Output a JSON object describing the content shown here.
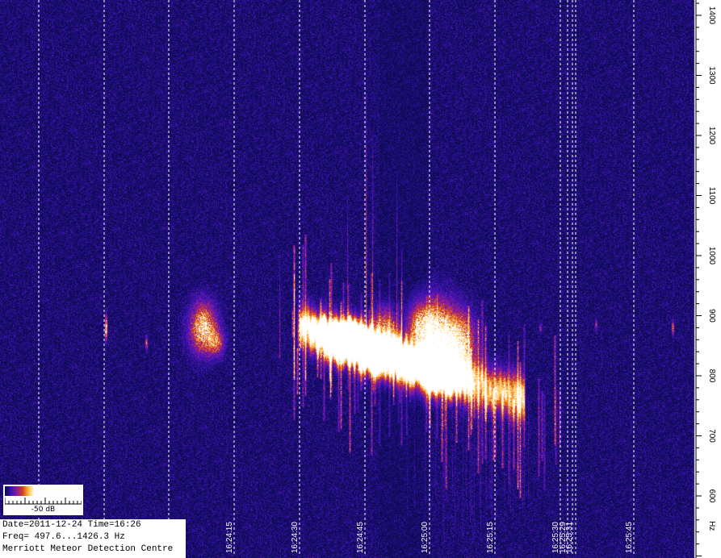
{
  "chart_data": {
    "type": "heatmap",
    "title": "",
    "xlabel": "",
    "ylabel": "Hz",
    "x_ticks": [
      "16:24:15",
      "16:24:30",
      "16:24:45",
      "16:25:00",
      "16:25:15",
      "16:25:30",
      "16:25:29",
      "16:25:31",
      "16:25:45"
    ],
    "y_ticks": [
      1400,
      1300,
      1200,
      1100,
      1000,
      900,
      800,
      700,
      600
    ],
    "ylim": [
      500,
      1410
    ],
    "grid": "vertical dashed white lines",
    "colormap": [
      "#0a0a4a",
      "#3a14b8",
      "#8a1aa0",
      "#d8401a",
      "#ffc040",
      "#ffffff"
    ],
    "legend": {
      "label": "-50 dB"
    },
    "echoes": [
      {
        "time": "16:24:08",
        "freq": 880,
        "spread": 40,
        "intensity": 0.9
      },
      {
        "time": "16:24:11",
        "freq": 855,
        "spread": 20,
        "intensity": 0.5
      },
      {
        "time": "16:24:43",
        "freq": 870,
        "spread": 25,
        "intensity": 0.8
      },
      {
        "time": "16:24:50",
        "freq": 885,
        "spread": 30,
        "intensity": 0.8
      },
      {
        "time": "16:24:58",
        "freq": 880,
        "spread": 40,
        "intensity": 1.0
      },
      {
        "time": "16:25:02",
        "freq": 860,
        "spread": 60,
        "intensity": 1.0
      },
      {
        "time": "16:25:07",
        "freq": 850,
        "spread": 50,
        "intensity": 0.9
      }
    ],
    "trail": {
      "start_time": "16:24:30",
      "end_time": "16:25:22",
      "freq_start": 880,
      "freq_end": 760,
      "peak_freq": 1270
    }
  },
  "legend_label": "-50 dB",
  "info": {
    "date_time": "Date=2011-12-24 Time=16:26",
    "freq_range": "Freq= 497.6...1426.3 Hz",
    "station": "Merriott Meteor Detection Centre"
  },
  "axis_unit": "Hz"
}
